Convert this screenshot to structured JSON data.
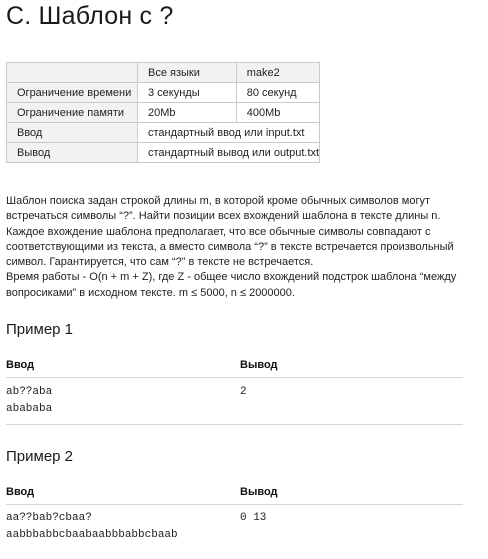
{
  "problem": {
    "title": "C. Шаблон с ?"
  },
  "limits": {
    "header": [
      "",
      "Все языки",
      "make2"
    ],
    "rows": [
      {
        "label": "Ограничение времени",
        "all": "3 секунды",
        "make2": "80 секунд"
      },
      {
        "label": "Ограничение памяти",
        "all": "20Mb",
        "make2": "400Mb"
      },
      {
        "label": "Ввод",
        "value": "стандартный ввод или input.txt"
      },
      {
        "label": "Вывод",
        "value": "стандартный вывод или output.txt"
      }
    ]
  },
  "statement": {
    "paragraph1": "Шаблон поиска задан строкой длины m, в которой кроме обычных символов могут встречаться символы “?”. Найти позиции всех вхождений шаблона в тексте длины n. Каждое вхождение шаблона предполагает, что все обычные символы совпадают с соответствующими из текста, а вместо символа “?” в тексте встречается произвольный символ. Гарантируется, что сам “?” в тексте не встречается.",
    "paragraph2": "Время работы - O(n + m + Z), где Z - общее число вхождений подстрок шаблона “между вопросиками” в исходном тексте. m ≤ 5000, n ≤ 2000000."
  },
  "examples": [
    {
      "title": "Пример 1",
      "input_header": "Ввод",
      "output_header": "Вывод",
      "input_lines": [
        "ab??aba",
        "abababa"
      ],
      "output_lines": [
        "2"
      ]
    },
    {
      "title": "Пример 2",
      "input_header": "Ввод",
      "output_header": "Вывод",
      "input_lines": [
        "aa??bab?cbaa?",
        "aabbbabbcbaabaabbbabbcbaab"
      ],
      "output_lines": [
        "0 13"
      ]
    }
  ]
}
